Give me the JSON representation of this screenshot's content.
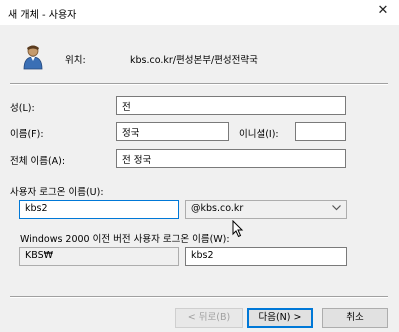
{
  "window": {
    "title": "새 개체 - 사용자",
    "close_glyph": "✕"
  },
  "location": {
    "label": "위치:",
    "value": "kbs.co.kr/편성본부/편성전략국"
  },
  "form": {
    "last_name": {
      "label": "성(L):",
      "value": "전"
    },
    "first_name": {
      "label": "이름(F):",
      "value": "정국"
    },
    "initials": {
      "label": "이니셜(I):",
      "value": ""
    },
    "full_name": {
      "label": "전체 이름(A):",
      "value": "전 정국"
    },
    "logon_name": {
      "label": "사용자 로그온 이름(U):",
      "value": "kbs2"
    },
    "upn_suffix": {
      "value": "@kbs.co.kr"
    },
    "pre2000": {
      "label": "Windows 2000 이전 버전 사용자 로그온 이름(W):",
      "domain": "KBS₩",
      "value": "kbs2"
    }
  },
  "buttons": {
    "back": "< 뒤로(B)",
    "next": "다음(N) >",
    "cancel": "취소"
  },
  "colors": {
    "accent": "#0078d7",
    "dialog_bg": "#f0f0f0"
  }
}
